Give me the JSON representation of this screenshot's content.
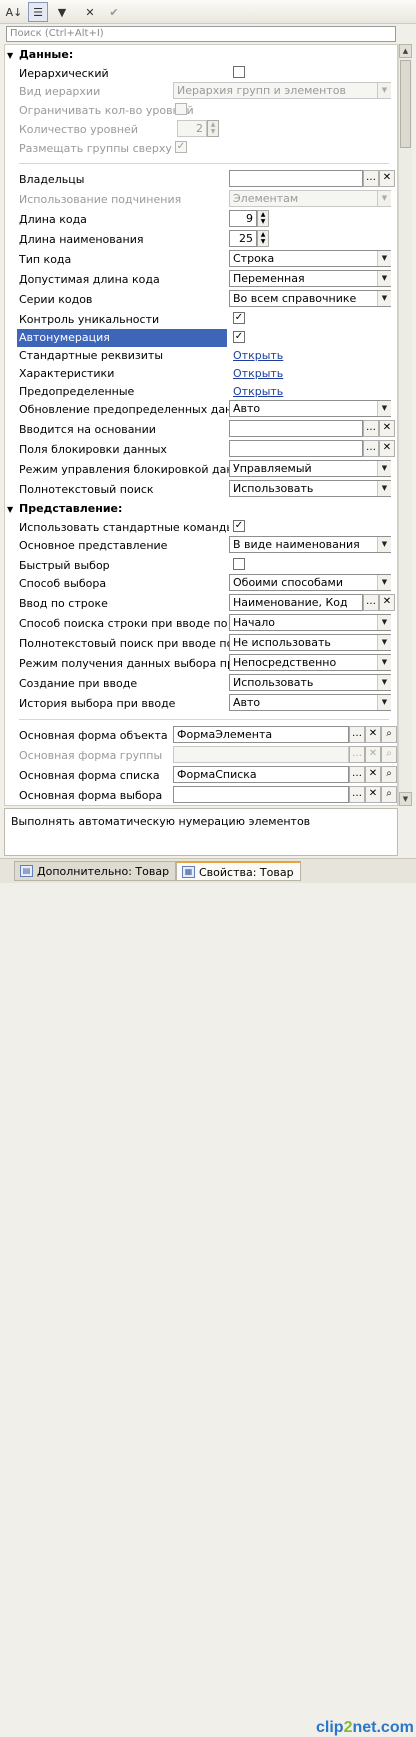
{
  "toolbar": {
    "sort_icon": "sort-az-icon",
    "buttons": [
      "sort-az",
      "categories",
      "filter",
      "clear",
      "apply"
    ]
  },
  "search": {
    "placeholder": "Поиск (Ctrl+Alt+I)"
  },
  "sections": {
    "data": "Данные:",
    "presentation": "Представление:"
  },
  "props": {
    "hierarchical": "Иерархический",
    "hierarchy_type": "Вид иерархии",
    "hierarchy_type_value": "Иерархия групп и элементов",
    "limit_levels": "Ограничивать кол-во уровней",
    "levels_count": "Количество уровней",
    "levels_count_value": "2",
    "groups_on_top": "Размещать группы сверху",
    "owners": "Владельцы",
    "subordination": "Использование подчинения",
    "subordination_value": "Элементам",
    "code_length": "Длина кода",
    "code_length_value": "9",
    "name_length": "Длина наименования",
    "name_length_value": "25",
    "code_type": "Тип кода",
    "code_type_value": "Строка",
    "allowed_length": "Допустимая длина кода",
    "allowed_length_value": "Переменная",
    "code_series": "Серии кодов",
    "code_series_value": "Во всем справочнике",
    "uniqueness": "Контроль уникальности",
    "autonumbering": "Автонумерация",
    "std_attributes": "Стандартные реквизиты",
    "characteristics": "Характеристики",
    "predefined": "Предопределенные",
    "open_link": "Открыть",
    "predefined_update": "Обновление предопределенных данных",
    "predefined_update_value": "Авто",
    "based_on": "Вводится на основании",
    "lock_fields": "Поля блокировки данных",
    "lock_mode": "Режим управления блокировкой данных",
    "lock_mode_value": "Управляемый",
    "fulltext": "Полнотекстовый поиск",
    "fulltext_value": "Использовать",
    "std_commands": "Использовать стандартные команды",
    "main_presentation": "Основное представление",
    "main_presentation_value": "В виде наименования",
    "quick_choice": "Быстрый выбор",
    "choice_mode": "Способ выбора",
    "choice_mode_value": "Обоими способами",
    "input_by_string": "Ввод по строке",
    "input_by_string_value": "Наименование, Код",
    "search_mode": "Способ поиска строки при вводе по строке",
    "search_mode_value": "Начало",
    "fulltext_input": "Полнотекстовый поиск при вводе по строке",
    "fulltext_input_value": "Не использовать",
    "data_mode": "Режим получения данных выбора при вводе",
    "data_mode_value": "Непосредственно",
    "create_on_input": "Создание при вводе",
    "create_on_input_value": "Использовать",
    "choice_history": "История выбора при вводе",
    "choice_history_value": "Авто",
    "object_form": "Основная форма объекта",
    "object_form_value": "ФормаЭлемента",
    "group_form": "Основная форма группы",
    "list_form": "Основная форма списка",
    "list_form_value": "ФормаСписка",
    "choice_form": "Основная форма выбора"
  },
  "hint": "Выполнять автоматическую нумерацию элементов",
  "tabs": [
    {
      "label": "Дополнительно: Товар"
    },
    {
      "label": "Свойства: Товар"
    }
  ],
  "watermark": {
    "a": "clip",
    "b": "2",
    "c": "net.com"
  },
  "colors": {
    "selection": "#3d65b8",
    "link": "#1c3ea0",
    "tab_accent": "#e8a33c"
  }
}
